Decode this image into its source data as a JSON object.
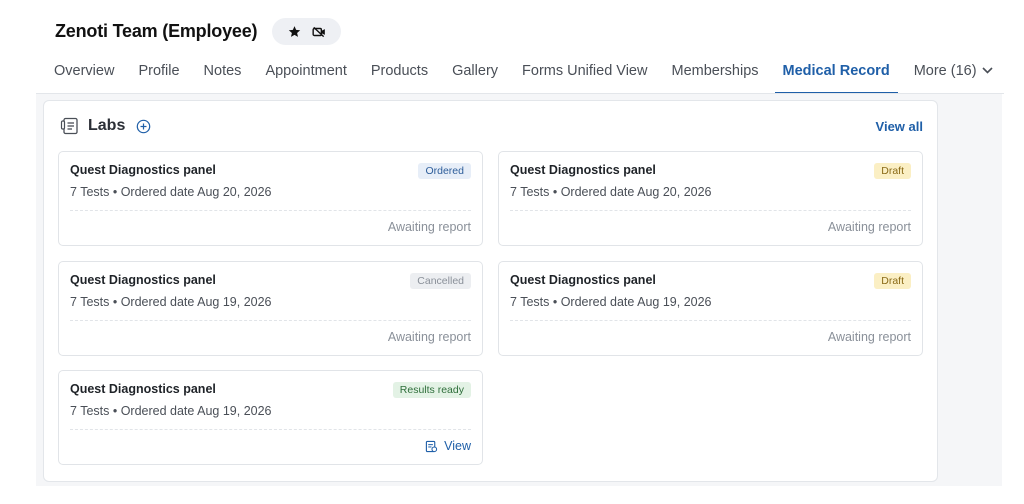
{
  "header": {
    "title": "Zenoti Team (Employee)",
    "icons": [
      "star-icon",
      "video-off-icon"
    ]
  },
  "tabs": [
    {
      "label": "Overview"
    },
    {
      "label": "Profile"
    },
    {
      "label": "Notes"
    },
    {
      "label": "Appointment"
    },
    {
      "label": "Products"
    },
    {
      "label": "Gallery"
    },
    {
      "label": "Forms Unified View"
    },
    {
      "label": "Memberships"
    },
    {
      "label": "Medical Record",
      "active": true
    },
    {
      "label": "More (16)",
      "icon": "chevron-down-icon"
    }
  ],
  "labs": {
    "title": "Labs",
    "view_all": "View all",
    "cards": [
      {
        "title": "Quest Diagnostics panel",
        "subtitle": "7 Tests • Ordered date Aug 20, 2026",
        "status": "Ordered",
        "footer": "Awaiting report"
      },
      {
        "title": "Quest Diagnostics panel",
        "subtitle": "7 Tests • Ordered date Aug 20, 2026",
        "status": "Draft",
        "footer": "Awaiting report"
      },
      {
        "title": "Quest Diagnostics panel",
        "subtitle": "7 Tests • Ordered date Aug 19, 2026",
        "status": "Cancelled",
        "footer": "Awaiting report"
      },
      {
        "title": "Quest Diagnostics panel",
        "subtitle": "7 Tests • Ordered date Aug 19, 2026",
        "status": "Draft",
        "footer": "Awaiting report"
      },
      {
        "title": "Quest Diagnostics panel",
        "subtitle": "7 Tests • Ordered date Aug 19, 2026",
        "status": "Results ready",
        "footer": "View",
        "footer_icon": "report-icon"
      }
    ]
  },
  "colors": {
    "accent": "#1f5fa8",
    "ordered_badge": "#e7eef8",
    "draft_badge": "#fbefc4",
    "cancelled_badge": "#eceef1",
    "results_badge": "#e3f2e5"
  }
}
